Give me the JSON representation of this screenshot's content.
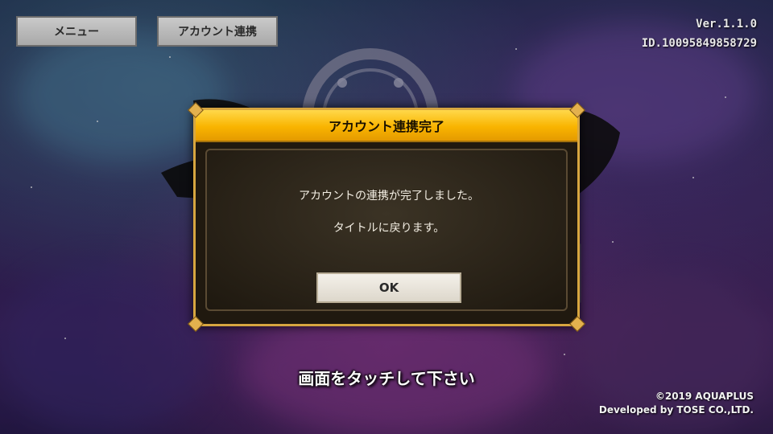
{
  "top_buttons": {
    "menu_label": "メニュー",
    "account_link_label": "アカウント連携"
  },
  "version_info": {
    "version": "Ver.1.1.0",
    "user_id": "ID.10095849858729"
  },
  "dialog": {
    "title": "アカウント連携完了",
    "message_line1": "アカウントの連携が完了しました。",
    "message_line2": "タイトルに戻ります。",
    "ok_label": "OK"
  },
  "touch_prompt": "画面をタッチして下さい",
  "credits": {
    "copyright": "©2019 AQUAPLUS",
    "developer": "Developed by TOSE CO.,LTD."
  },
  "colors": {
    "dialog_header": "#f9b400",
    "dialog_border": "#d7a640",
    "dialog_body": "#2a2318"
  },
  "icons": {
    "logo": "game-title-logo-icon"
  }
}
